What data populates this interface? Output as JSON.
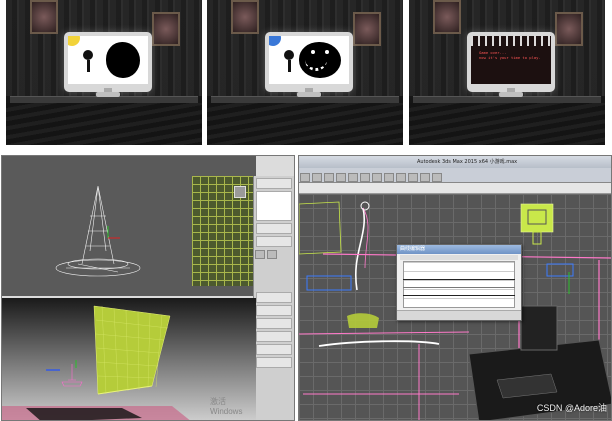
{
  "panels": {
    "frame1": {
      "sun_color": "#f2d33a"
    },
    "frame2": {
      "sun_color": "#3a78d8"
    },
    "frame3": {
      "text": "Game over...\nnow it's your time to play."
    }
  },
  "viewport_left": {
    "watermark": "激活 Windows"
  },
  "viewport_right": {
    "titlebar": "Autodesk 3ds Max 2015 x64    小游戏.max",
    "dialog_title": "曲线编辑器"
  },
  "credit": "CSDN @Adore油"
}
